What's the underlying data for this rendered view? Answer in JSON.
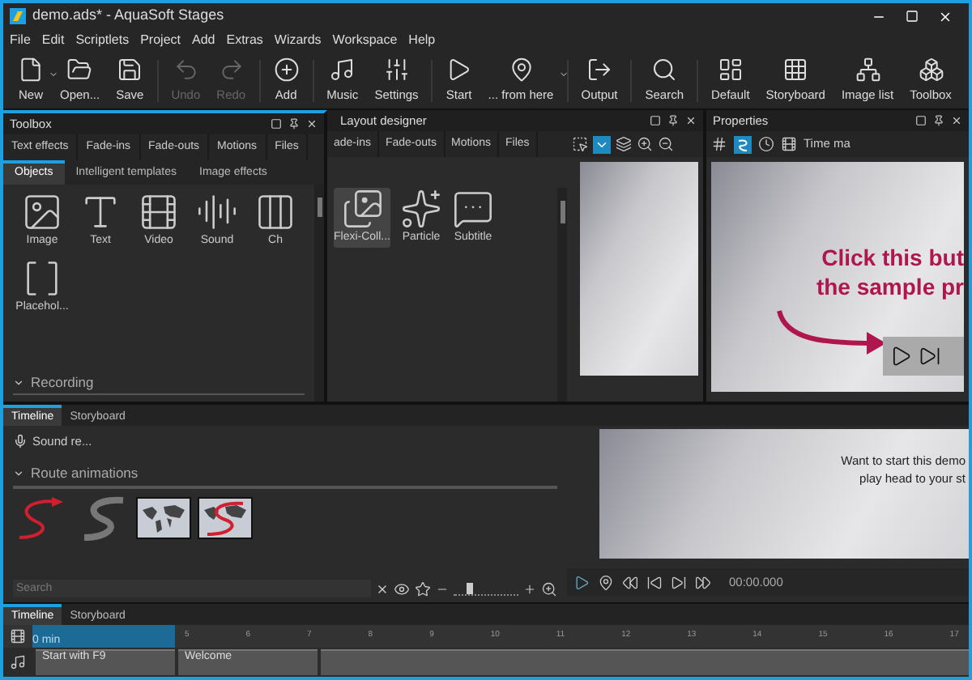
{
  "window": {
    "title": "demo.ads* - AquaSoft Stages"
  },
  "menu": [
    "File",
    "Edit",
    "Scriptlets",
    "Project",
    "Add",
    "Extras",
    "Wizards",
    "Workspace",
    "Help"
  ],
  "toolbar": [
    {
      "label": "New",
      "disabled": false,
      "dropdown": true
    },
    {
      "label": "Open...",
      "disabled": false,
      "dropdown": false
    },
    {
      "label": "Save",
      "disabled": false,
      "dropdown": false
    },
    {
      "label": "Undo",
      "disabled": true,
      "dropdown": false
    },
    {
      "label": "Redo",
      "disabled": true,
      "dropdown": false
    },
    {
      "label": "Add",
      "disabled": false,
      "dropdown": false
    },
    {
      "label": "Music",
      "disabled": false,
      "dropdown": false
    },
    {
      "label": "Settings",
      "disabled": false,
      "dropdown": false
    },
    {
      "label": "Start",
      "disabled": false,
      "dropdown": false
    },
    {
      "label": "... from here",
      "disabled": false,
      "dropdown": true
    },
    {
      "label": "Output",
      "disabled": false,
      "dropdown": false
    },
    {
      "label": "Search",
      "disabled": false,
      "dropdown": false
    },
    {
      "label": "Default",
      "disabled": false,
      "dropdown": false
    },
    {
      "label": "Storyboard",
      "disabled": false,
      "dropdown": false
    },
    {
      "label": "Image list",
      "disabled": false,
      "dropdown": false
    },
    {
      "label": "Toolbox",
      "disabled": false,
      "dropdown": false
    }
  ],
  "toolbox": {
    "title": "Toolbox",
    "tabs_top": [
      "Text effects",
      "Fade-ins",
      "Fade-outs",
      "Motions",
      "Files"
    ],
    "tabs": [
      {
        "label": "Objects",
        "selected": true
      },
      {
        "label": "Intelligent templates",
        "selected": false
      },
      {
        "label": "Image effects",
        "selected": false
      }
    ],
    "items": [
      "Image",
      "Text",
      "Video",
      "Sound",
      "Ch",
      "Placehol..."
    ],
    "section": "Recording"
  },
  "layout_designer": {
    "title": "Layout designer",
    "tabs": [
      "ade-ins",
      "Fade-outs",
      "Motions",
      "Files"
    ],
    "items": [
      "Flexi-Coll...",
      "Particle",
      "Subtitle"
    ]
  },
  "properties": {
    "title": "Properties",
    "tool_label": "Time ma",
    "preview_lines": [
      "Click this but",
      "the sample pr"
    ]
  },
  "lower_panel": {
    "tabs": [
      {
        "label": "Timeline",
        "selected": true
      },
      {
        "label": "Storyboard",
        "selected": false
      }
    ],
    "item": "Sound re...",
    "section": "Route animations",
    "search": {
      "placeholder": "Search"
    },
    "zoom": {
      "level": 0.25
    }
  },
  "preview2": {
    "lines": [
      "Want to start this demo",
      "play head to your st"
    ],
    "time": "00:00.000"
  },
  "timeline": {
    "tabs": [
      {
        "label": "Timeline",
        "selected": true
      },
      {
        "label": "Storyboard",
        "selected": false
      }
    ],
    "ruler_label": "0 min",
    "ticks": [
      "5",
      "6",
      "7",
      "8",
      "9",
      "10",
      "11",
      "12",
      "13",
      "14",
      "15",
      "16",
      "17"
    ],
    "clips": [
      "Start with F9",
      "Welcome"
    ]
  }
}
